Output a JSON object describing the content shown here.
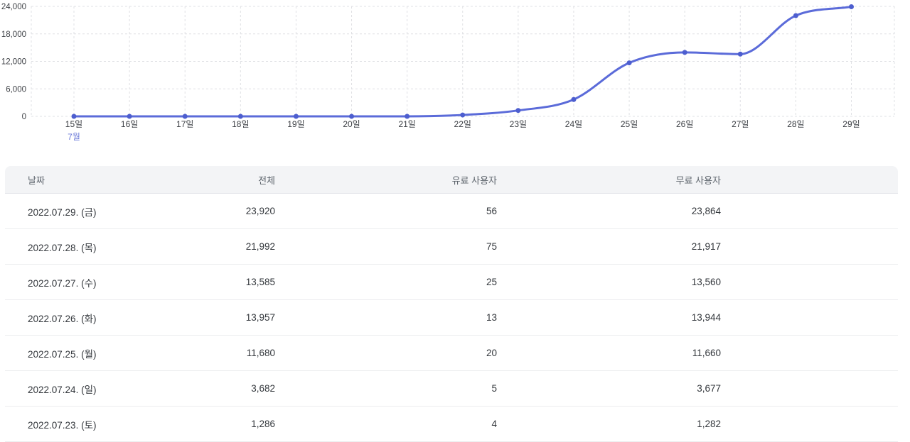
{
  "chart": {
    "month_label": "7월",
    "y_ticks": [
      "0",
      "6,000",
      "12,000",
      "18,000",
      "24,000"
    ],
    "colors": {
      "line": "#5b6bd9",
      "dot": "#4d5ecf",
      "grid": "#dfe0e4",
      "axis_text": "#3e4146",
      "month_text": "#6b79d8"
    }
  },
  "chart_data": {
    "type": "line",
    "x": [
      "15일",
      "16일",
      "17일",
      "18일",
      "19일",
      "20일",
      "21일",
      "22일",
      "23일",
      "24일",
      "25일",
      "26일",
      "27일",
      "28일",
      "29일"
    ],
    "values": [
      0,
      0,
      0,
      0,
      0,
      0,
      0,
      300,
      1286,
      3682,
      11680,
      13957,
      13585,
      21992,
      23920
    ],
    "title": "",
    "xlabel": "7월",
    "ylabel": "",
    "ylim": [
      0,
      24000
    ],
    "y_tick_values": [
      0,
      6000,
      12000,
      18000,
      24000
    ],
    "grid": true,
    "smooth": true,
    "legend": "none"
  },
  "table": {
    "columns": [
      "날짜",
      "전체",
      "유료 사용자",
      "무료 사용자"
    ],
    "rows": [
      {
        "date": "2022.07.29. (금)",
        "total": "23,920",
        "paid": "56",
        "free": "23,864"
      },
      {
        "date": "2022.07.28. (목)",
        "total": "21,992",
        "paid": "75",
        "free": "21,917"
      },
      {
        "date": "2022.07.27. (수)",
        "total": "13,585",
        "paid": "25",
        "free": "13,560"
      },
      {
        "date": "2022.07.26. (화)",
        "total": "13,957",
        "paid": "13",
        "free": "13,944"
      },
      {
        "date": "2022.07.25. (월)",
        "total": "11,680",
        "paid": "20",
        "free": "11,660"
      },
      {
        "date": "2022.07.24. (일)",
        "total": "3,682",
        "paid": "5",
        "free": "3,677"
      },
      {
        "date": "2022.07.23. (토)",
        "total": "1,286",
        "paid": "4",
        "free": "1,282"
      }
    ]
  }
}
